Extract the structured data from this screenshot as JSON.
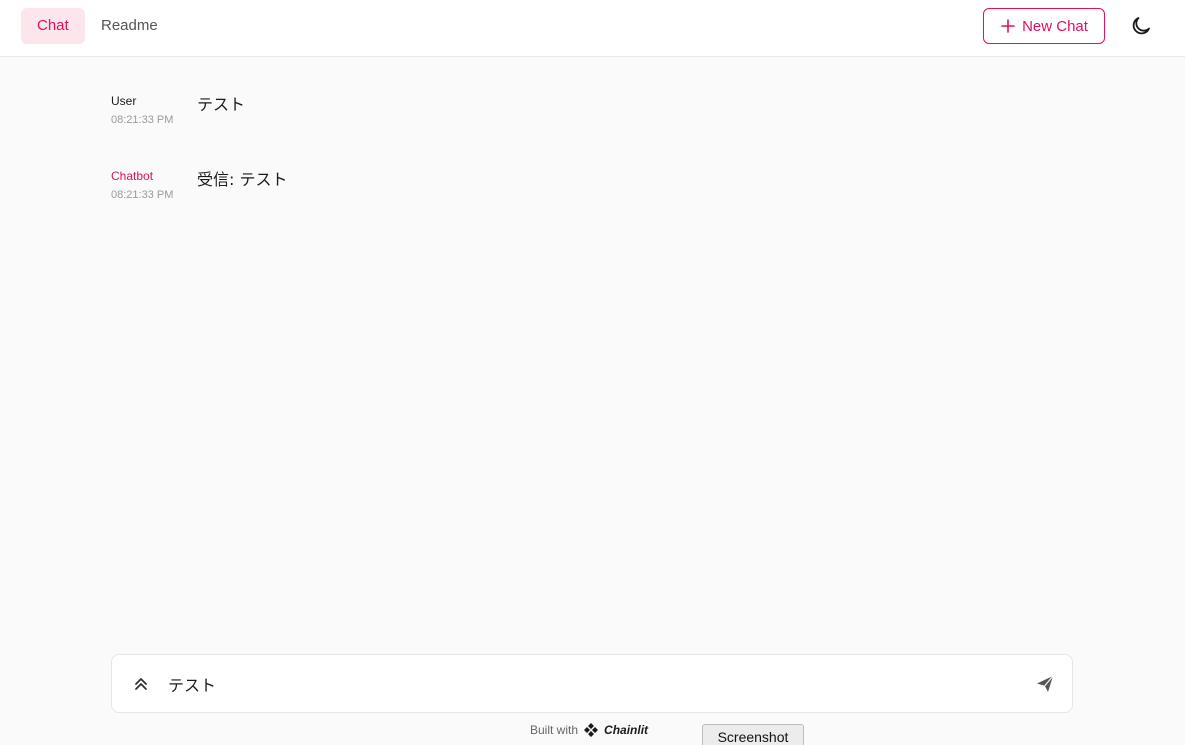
{
  "header": {
    "tabs": [
      {
        "label": "Chat",
        "active": true
      },
      {
        "label": "Readme",
        "active": false
      }
    ],
    "new_chat_label": "New Chat",
    "theme_icon": "moon-icon"
  },
  "messages": [
    {
      "author": "User",
      "time": "08:21:33 PM",
      "content": "テスト"
    },
    {
      "author": "Chatbot",
      "time": "08:21:33 PM",
      "content": "受信: テスト"
    }
  ],
  "composer": {
    "value": "テスト",
    "expand_icon": "chevrons-up-icon",
    "send_icon": "send-icon"
  },
  "footer": {
    "built_with": "Built with",
    "brand": "Chainlit"
  },
  "screenshot_button": "Screenshot",
  "colors": {
    "accent": "#e0105f",
    "active_tab_bg": "#fce6ec",
    "background": "#fafafa"
  }
}
